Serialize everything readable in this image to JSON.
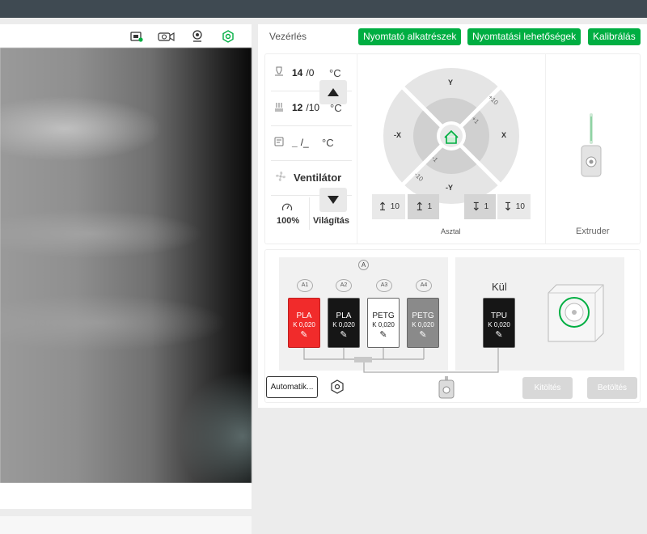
{
  "camera": {
    "toolbar_icons": [
      "record-icon",
      "timelapse-icon",
      "webcam-icon",
      "ams-settings-icon"
    ]
  },
  "control": {
    "title": "Vezérlés",
    "buttons": [
      "Nyomtató alkatrészek",
      "Nyomtatási lehetőségek",
      "Kalibrálás"
    ]
  },
  "temps": {
    "nozzle": {
      "current": "14",
      "target": "/0",
      "unit": "°C"
    },
    "bed": {
      "current": "12",
      "target": "/10",
      "unit": "°C"
    },
    "chamber": {
      "current": "_",
      "target": "/_",
      "unit": "°C"
    }
  },
  "fan": {
    "label": "Ventilátor"
  },
  "speed": {
    "value": "100%"
  },
  "light": {
    "label": "Világítás"
  },
  "jog": {
    "y_plus": "Y",
    "y_minus": "-Y",
    "x_plus": "X",
    "x_minus": "-X",
    "plus10": "+10",
    "plus1": "+1",
    "minus1": "-1",
    "minus10": "-10"
  },
  "bed_controls": {
    "up10": "10",
    "up1": "1",
    "label": "Asztal",
    "down1": "1",
    "down10": "10"
  },
  "extruder": {
    "label": "Extruder"
  },
  "ams": {
    "top_label": "A",
    "slots": [
      {
        "id": "A1",
        "type": "PLA",
        "k": "K 0,020",
        "color": "#f12b2b",
        "text": "#ffffff"
      },
      {
        "id": "A2",
        "type": "PLA",
        "k": "K 0,020",
        "color": "#161616",
        "text": "#ffffff"
      },
      {
        "id": "A3",
        "type": "PETG",
        "k": "K 0,020",
        "color": "#ffffff",
        "text": "#222222"
      },
      {
        "id": "A4",
        "type": "PETG",
        "k": "K 0,020",
        "color": "#8a8a8a",
        "text": "#ffffff"
      }
    ],
    "external": {
      "label": "Kül",
      "type": "TPU",
      "k": "K 0,020",
      "color": "#161616"
    },
    "auto_button": "Automatik...",
    "unload_button": "Kitöltés",
    "load_button": "Betöltés"
  },
  "colors": {
    "accent": "#00ae42",
    "topbar": "#3f4a52"
  }
}
